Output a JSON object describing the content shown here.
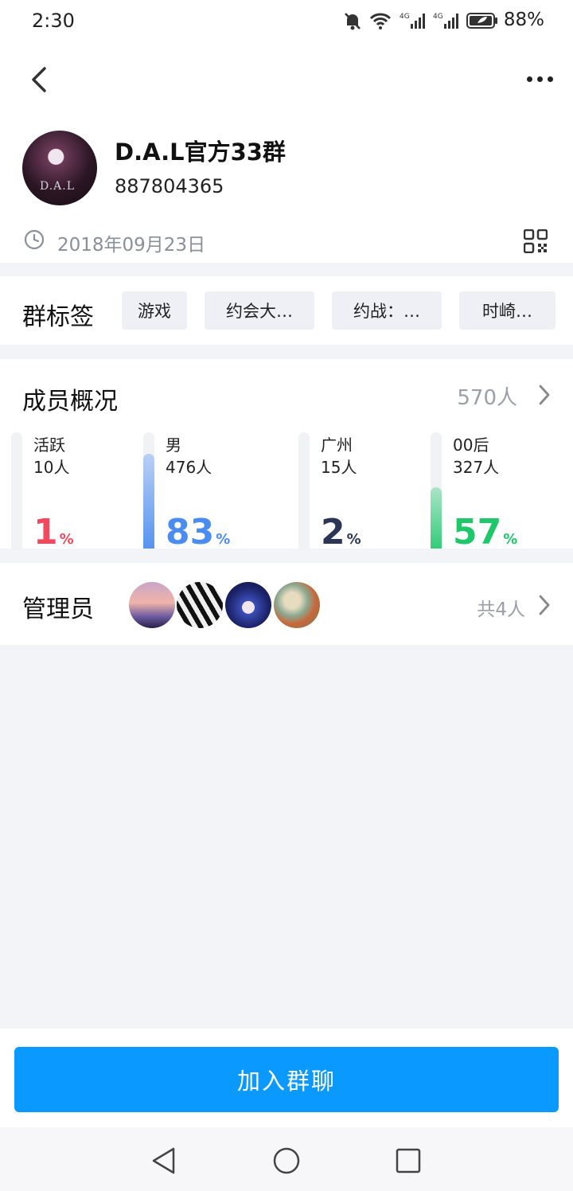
{
  "status_bar": {
    "time": "2:30",
    "battery": "88%"
  },
  "group": {
    "name": "D.A.L官方33群",
    "id": "887804365",
    "created_date": "2018年09月23日",
    "avatar_text": "D.A.L"
  },
  "tags": {
    "title": "群标签",
    "items": [
      "游戏",
      "约会大…",
      "约战：…",
      "时崎…"
    ]
  },
  "members": {
    "title": "成员概况",
    "total": "570人",
    "stats": [
      {
        "label": "活跃",
        "count": "10人",
        "percent": "1",
        "value": 1,
        "color": "#f2475c"
      },
      {
        "label": "男",
        "count": "476人",
        "percent": "83",
        "value": 83,
        "color": "#4a8cf0"
      },
      {
        "label": "广州",
        "count": "15人",
        "percent": "2",
        "value": 2,
        "color": "#2b3656"
      },
      {
        "label": "00后",
        "count": "327人",
        "percent": "57",
        "value": 57,
        "color": "#1ec86a"
      }
    ],
    "percent_sign": "%"
  },
  "admins": {
    "title": "管理员",
    "count": "共4人"
  },
  "join_button": "加入群聊",
  "colors": {
    "accent": "#0a99ff"
  }
}
